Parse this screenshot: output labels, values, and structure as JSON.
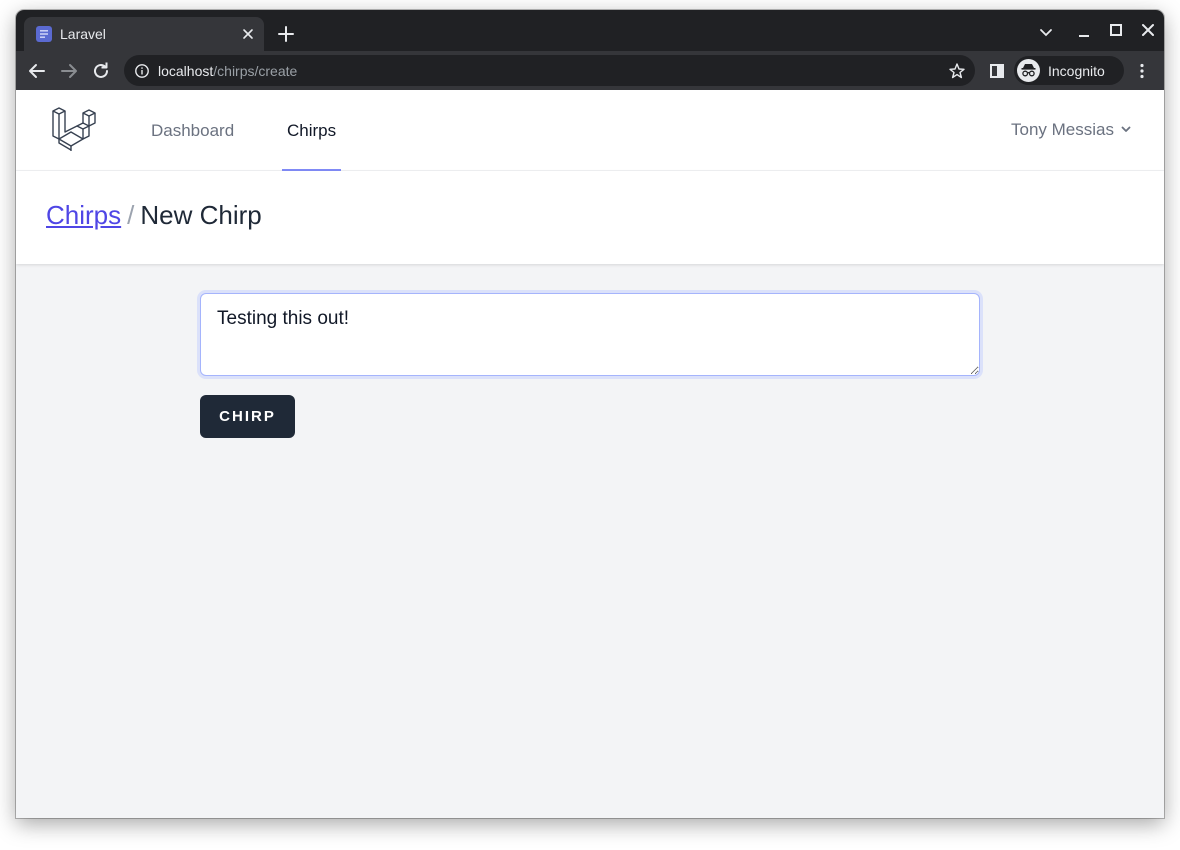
{
  "browser": {
    "tab_title": "Laravel",
    "url_host": "localhost",
    "url_path": "/chirps/create",
    "profile_label": "Incognito"
  },
  "nav": {
    "links": [
      {
        "label": "Dashboard",
        "active": false
      },
      {
        "label": "Chirps",
        "active": true
      }
    ],
    "user_name": "Tony Messias"
  },
  "header": {
    "breadcrumb_parent": "Chirps",
    "separator": "/",
    "page_title": "New Chirp"
  },
  "form": {
    "message_value": "Testing this out!",
    "submit_label": "CHIRP"
  },
  "colors": {
    "accent": "#4f46e5",
    "active_underline": "#818cf8",
    "button_bg": "#1f2937",
    "page_bg": "#f3f4f6"
  }
}
